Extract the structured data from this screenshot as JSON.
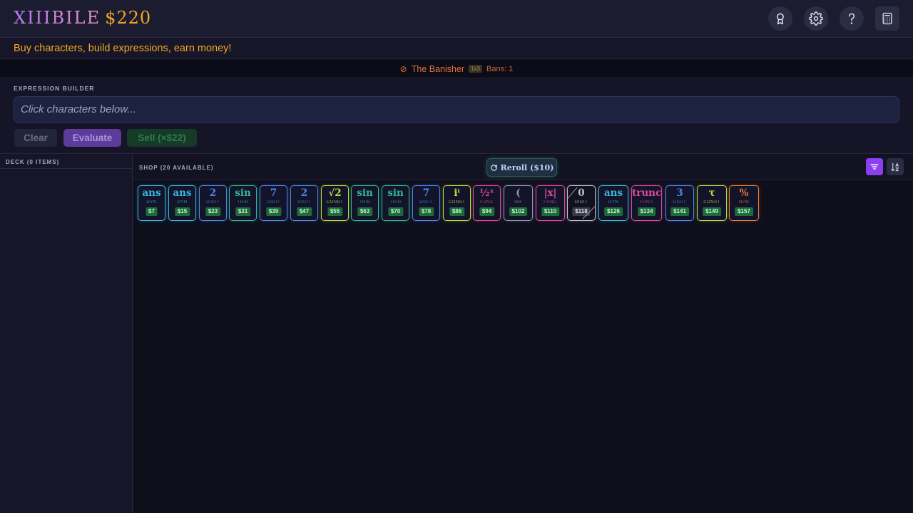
{
  "header": {
    "title": "XIIIBILE",
    "money": "$220"
  },
  "tagline": "Buy characters, build expressions, earn money!",
  "boss": {
    "icon": "⊘",
    "name": "The Banisher",
    "tag": "1x3",
    "bans": "Bans: 1"
  },
  "builder": {
    "label": "EXPRESSION BUILDER",
    "placeholder": "Click characters below...",
    "clear": "Clear",
    "evaluate": "Evaluate",
    "sell": "Sell (×$22)"
  },
  "deck": {
    "label": "DECK (0 ITEMS)"
  },
  "shop": {
    "label": "SHOP (20 AVAILABLE)",
    "reroll": "Reroll ($10)",
    "cards": [
      {
        "glyph": "ans",
        "type": "DYN",
        "price": "$7",
        "color": "#38b8e0"
      },
      {
        "glyph": "ans",
        "type": "DYN",
        "price": "$15",
        "color": "#38b8e0"
      },
      {
        "glyph": "2",
        "type": "DIGIT",
        "price": "$23",
        "color": "#4a8af0"
      },
      {
        "glyph": "sin",
        "type": "TRIG",
        "price": "$31",
        "color": "#2fb89a"
      },
      {
        "glyph": "7",
        "type": "DIGIT",
        "price": "$39",
        "color": "#4a8af0"
      },
      {
        "glyph": "2",
        "type": "DIGIT",
        "price": "$47",
        "color": "#4a8af0"
      },
      {
        "glyph": "√2",
        "type": "CONST",
        "price": "$55",
        "color": "#b8e040"
      },
      {
        "glyph": "sin",
        "type": "TRIG",
        "price": "$63",
        "color": "#2fb89a"
      },
      {
        "glyph": "sin",
        "type": "TRIG",
        "price": "$70",
        "color": "#2fb89a"
      },
      {
        "glyph": "7",
        "type": "DIGIT",
        "price": "$78",
        "color": "#4a8af0"
      },
      {
        "glyph": "iⁱ",
        "type": "CONST",
        "price": "$86",
        "color": "#b8e040"
      },
      {
        "glyph": "½ˣ",
        "type": "FUNC",
        "price": "$94",
        "color": "#e04a9a"
      },
      {
        "glyph": "(",
        "type": "GR",
        "price": "$102",
        "color": "#8a9ab8"
      },
      {
        "glyph": "|x|",
        "type": "FUNC",
        "price": "$110",
        "color": "#e04a9a"
      },
      {
        "glyph": "0",
        "type": "DIGIT",
        "price": "$118",
        "color": "#c0c0d0",
        "banned": true
      },
      {
        "glyph": "ans",
        "type": "DYN",
        "price": "$126",
        "color": "#38b8e0"
      },
      {
        "glyph": "trunc",
        "type": "FUNC",
        "price": "$134",
        "color": "#e04a9a"
      },
      {
        "glyph": "3",
        "type": "DIGIT",
        "price": "$141",
        "color": "#4a8af0"
      },
      {
        "glyph": "τ",
        "type": "CONST",
        "price": "$149",
        "color": "#b8e040"
      },
      {
        "glyph": "%",
        "type": "OPR",
        "price": "$157",
        "color": "#f07a3a"
      }
    ]
  },
  "icons": [
    "badge-icon",
    "gear-icon",
    "help-icon",
    "calculator-icon",
    "filter-icon",
    "sort-icon",
    "reroll-icon",
    "ban-icon"
  ]
}
